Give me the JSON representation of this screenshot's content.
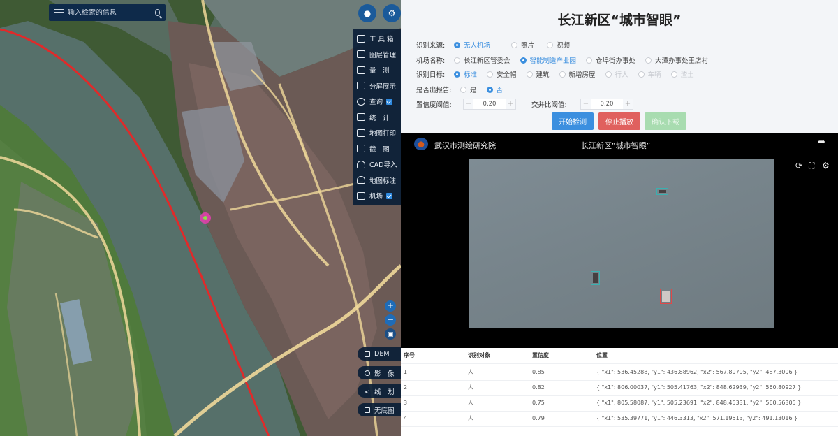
{
  "search": {
    "placeholder": "输入检索的信息"
  },
  "toolbar": {
    "items": [
      {
        "label": "工 具 箱",
        "icon": "toolbox-icon"
      },
      {
        "label": "图层管理",
        "icon": "layers-icon"
      },
      {
        "label": "量　测",
        "icon": "measure-icon"
      },
      {
        "label": "分屏展示",
        "icon": "split-screen-icon"
      },
      {
        "label": "查询",
        "icon": "query-icon",
        "checked": true
      },
      {
        "label": "统　计",
        "icon": "statistics-icon"
      },
      {
        "label": "地图打印",
        "icon": "print-icon"
      },
      {
        "label": "截　图",
        "icon": "screenshot-icon"
      },
      {
        "label": "CAD导入",
        "icon": "cad-import-icon"
      },
      {
        "label": "地图标注",
        "icon": "map-marker-icon"
      },
      {
        "label": "机场",
        "icon": "camera-icon",
        "checked": true
      }
    ]
  },
  "map_bottom": {
    "dem": "DEM",
    "imagery": "影　像",
    "vector": "线　划",
    "nobase": "无底图"
  },
  "panel": {
    "title": "长江新区“城市智眼”",
    "source": {
      "label": "识别来源:",
      "options": [
        "无人机场",
        "照片",
        "视频"
      ],
      "selected": 0
    },
    "site": {
      "label": "机场名称:",
      "options": [
        "长江新区管委会",
        "智能制造产业园",
        "仓埠街办事处",
        "大潭办事处王店村"
      ],
      "selected": 1
    },
    "target": {
      "label": "识别目标:",
      "options": [
        "标准",
        "安全帽",
        "建筑",
        "新增房屋",
        "行人",
        "车辆",
        "渣土"
      ],
      "selected": 0,
      "disabled": [
        4,
        5,
        6
      ]
    },
    "report": {
      "label": "是否出报告:",
      "options": [
        "是",
        "否"
      ],
      "selected": 1
    },
    "confidence": {
      "label": "置信度阈值:",
      "value": "0.20"
    },
    "iou": {
      "label": "交并比阈值:",
      "value": "0.20"
    },
    "buttons": {
      "start": "开始检测",
      "stop": "停止播放",
      "third": "确认下载"
    },
    "colors": {
      "accent": "#3b8fdf",
      "stop": "#e0605e",
      "disabled": "#a8dcb0"
    }
  },
  "viewer": {
    "org": "武汉市测绘研究院",
    "title": "长江新区“城市智眼”"
  },
  "results": {
    "columns": [
      "序号",
      "识别对象",
      "置信度",
      "位置"
    ],
    "rows": [
      [
        "1",
        "人",
        "0.85",
        "{ \"x1\": 536.45288, \"y1\": 436.88962, \"x2\": 567.89795, \"y2\": 487.3006 }"
      ],
      [
        "2",
        "人",
        "0.82",
        "{ \"x1\": 806.00037, \"y1\": 505.41763, \"x2\": 848.62939, \"y2\": 560.80927 }"
      ],
      [
        "3",
        "人",
        "0.75",
        "{ \"x1\": 805.58087, \"y1\": 505.23691, \"x2\": 848.45331, \"y2\": 560.56305 }"
      ],
      [
        "4",
        "人",
        "0.79",
        "{ \"x1\": 535.39771, \"y1\": 446.3313, \"x2\": 571.19513, \"y2\": 491.13016 }"
      ]
    ]
  }
}
